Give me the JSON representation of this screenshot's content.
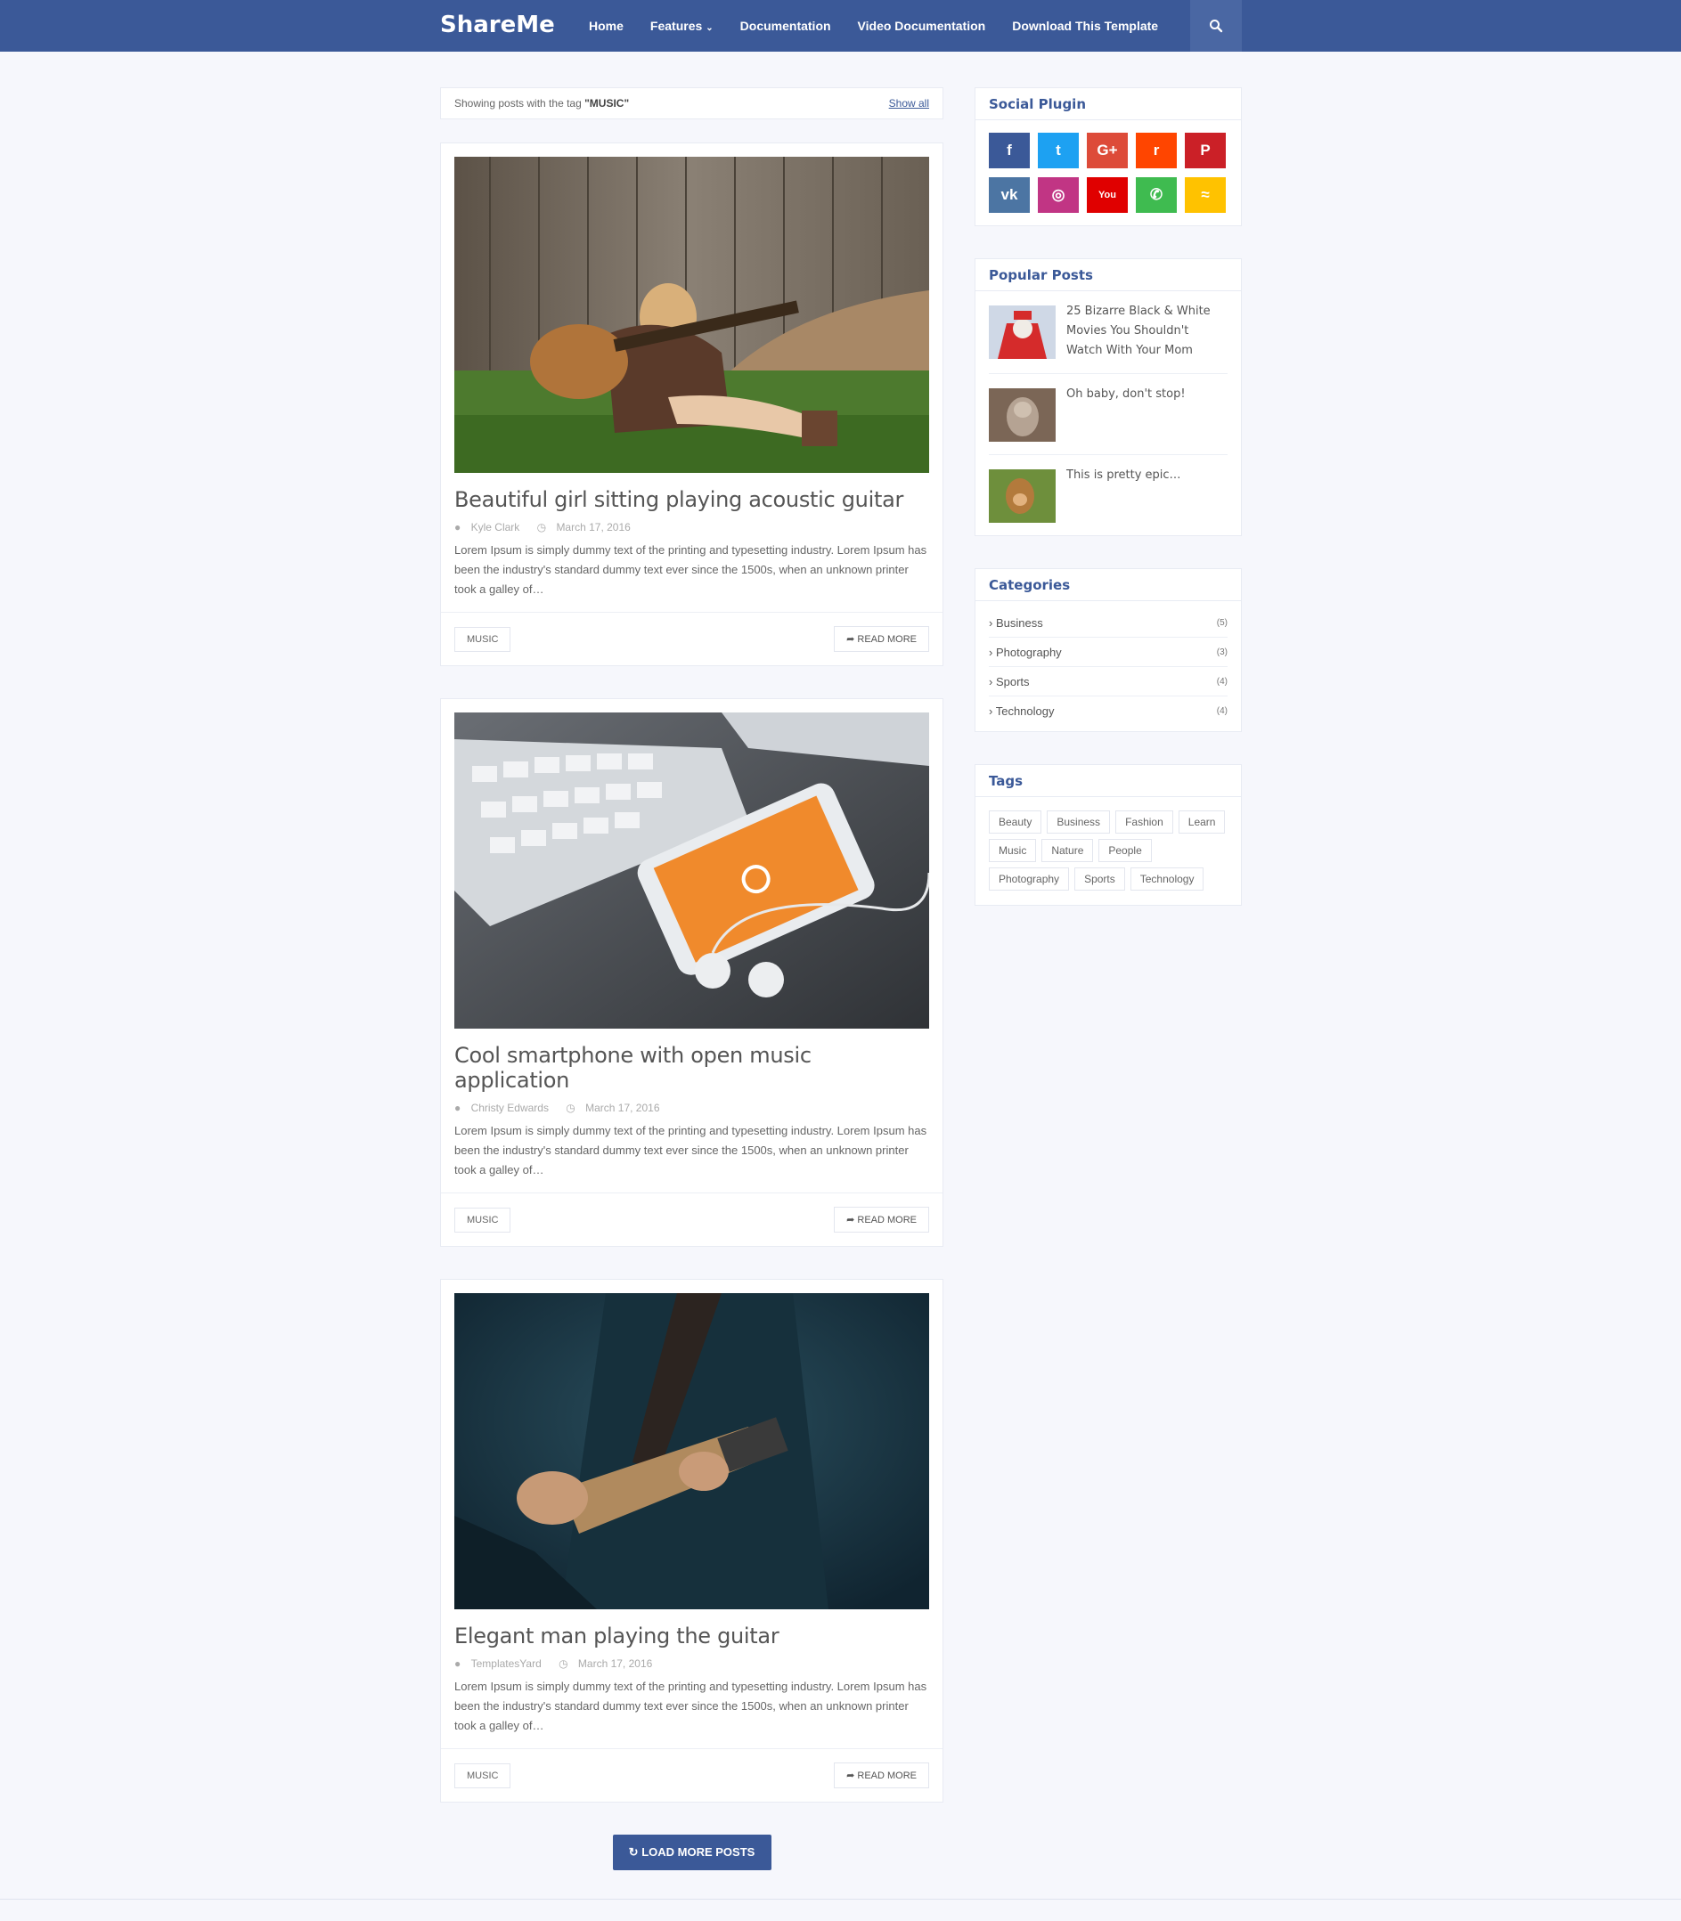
{
  "header": {
    "logo": "ShareMe",
    "nav": [
      {
        "label": "Home"
      },
      {
        "label": "Features",
        "caret": "⌄"
      },
      {
        "label": "Documentation"
      },
      {
        "label": "Video Documentation"
      },
      {
        "label": "Download This Template"
      }
    ],
    "search_icon": "search-icon"
  },
  "tag_bar": {
    "prefix": "Showing posts with the tag ",
    "tag": "\"MUSIC\"",
    "show_all": "Show all"
  },
  "posts": [
    {
      "title": "Beautiful girl sitting playing acoustic guitar",
      "author": "Kyle Clark",
      "date": "March 17, 2016",
      "excerpt": "Lorem Ipsum is simply dummy text of the printing and typesetting industry. Lorem Ipsum has been the industry's standard dummy text ever since the 1500s, when an unknown printer took a galley of…",
      "label": "MUSIC",
      "read_more": "READ MORE",
      "image": "girl-with-acoustic-guitar-photo"
    },
    {
      "title": "Cool smartphone with open music application",
      "author": "Christy Edwards",
      "date": "March 17, 2016",
      "excerpt": "Lorem Ipsum is simply dummy text of the printing and typesetting industry. Lorem Ipsum has been the industry's standard dummy text ever since the 1500s, when an unknown printer took a galley of…",
      "label": "MUSIC",
      "read_more": "READ MORE",
      "image": "smartphone-keyboard-earphones-photo"
    },
    {
      "title": "Elegant man playing the guitar",
      "author": "TemplatesYard",
      "date": "March 17, 2016",
      "excerpt": "Lorem Ipsum is simply dummy text of the printing and typesetting industry. Lorem Ipsum has been the industry's standard dummy text ever since the 1500s, when an unknown printer took a galley of…",
      "label": "MUSIC",
      "read_more": "READ MORE",
      "image": "man-playing-electric-guitar-photo"
    }
  ],
  "load_more": "LOAD MORE POSTS",
  "sidebar": {
    "social": {
      "title": "Social Plugin",
      "items": [
        {
          "name": "facebook",
          "glyph": "f",
          "color": "#3b5998"
        },
        {
          "name": "twitter",
          "glyph": "t",
          "color": "#1da1f2"
        },
        {
          "name": "google-plus",
          "glyph": "G+",
          "color": "#dd4b39"
        },
        {
          "name": "reddit",
          "glyph": "r",
          "color": "#ff4500"
        },
        {
          "name": "pinterest",
          "glyph": "P",
          "color": "#cb2027"
        },
        {
          "name": "vk",
          "glyph": "vk",
          "color": "#4c75a3"
        },
        {
          "name": "instagram",
          "glyph": "◎",
          "color": "#c13584"
        },
        {
          "name": "youtube",
          "glyph": "You",
          "color": "#e00000"
        },
        {
          "name": "whatsapp",
          "glyph": "✆",
          "color": "#3fbb50"
        },
        {
          "name": "rss",
          "glyph": "≈",
          "color": "#ffc200"
        }
      ]
    },
    "popular": {
      "title": "Popular Posts",
      "items": [
        {
          "title": "25 Bizarre Black & White Movies You Shouldn't Watch With Your Mom",
          "image": "santa-thumbnail"
        },
        {
          "title": "Oh baby, don't stop!",
          "image": "cat-thumbnail"
        },
        {
          "title": "This is pretty epic…",
          "image": "monkey-thumbnail"
        }
      ]
    },
    "categories": {
      "title": "Categories",
      "items": [
        {
          "label": "Business",
          "count": "(5)"
        },
        {
          "label": "Photography",
          "count": "(3)"
        },
        {
          "label": "Sports",
          "count": "(4)"
        },
        {
          "label": "Technology",
          "count": "(4)"
        }
      ]
    },
    "tags": {
      "title": "Tags",
      "items": [
        "Beauty",
        "Business",
        "Fashion",
        "Learn",
        "Music",
        "Nature",
        "People",
        "Photography",
        "Sports",
        "Technology"
      ]
    }
  },
  "colors": {
    "brand": "#3b5998",
    "background": "#f6f7fc"
  }
}
